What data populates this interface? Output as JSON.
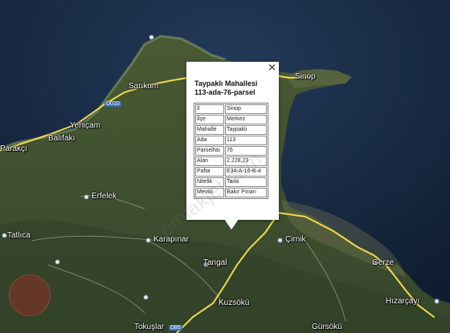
{
  "map": {
    "places": [
      {
        "id": "sarikum",
        "name": "Sarıkum"
      },
      {
        "id": "sinop",
        "name": "Sinop"
      },
      {
        "id": "yenicam",
        "name": "Yeniçam"
      },
      {
        "id": "balifaki",
        "name": "Balıfakı"
      },
      {
        "id": "parakci",
        "name": "Parakçı"
      },
      {
        "id": "erfelek",
        "name": "Erfelek"
      },
      {
        "id": "tatlica",
        "name": "Tatlıca"
      },
      {
        "id": "karapinar",
        "name": "Karapınar"
      },
      {
        "id": "cirnik",
        "name": "Çirnik"
      },
      {
        "id": "gerze",
        "name": "Gerze"
      },
      {
        "id": "tangal",
        "name": "Tangal"
      },
      {
        "id": "kuzsoku",
        "name": "Kuzsökü"
      },
      {
        "id": "hizarcayi",
        "name": "Hızarçayı"
      },
      {
        "id": "tokuslar",
        "name": "Tokuşlar"
      },
      {
        "id": "gursoku",
        "name": "Gürsökü"
      }
    ],
    "road_shields": [
      "D010",
      "D85"
    ]
  },
  "popup": {
    "title_line1": "Taypaklı Mahallesi",
    "title_line2": "113-ada-76-parsel",
    "close_symbol": "×",
    "rows": [
      {
        "key": "İl",
        "value": "Sinop"
      },
      {
        "key": "İlçe",
        "value": "Merkez"
      },
      {
        "key": "Mahalle",
        "value": "Taypaklı"
      },
      {
        "key": "Ada",
        "value": "113"
      },
      {
        "key": "ParselNo",
        "value": "76"
      },
      {
        "key": "Alan",
        "value": "2.228,23"
      },
      {
        "key": "Pafta",
        "value": "E34-A-16-B-4"
      },
      {
        "key": "Nitelik",
        "value": "Tarla"
      },
      {
        "key": "Mevkii",
        "value": "Bakır Pınarı"
      }
    ]
  },
  "watermark": "emlakjet.com"
}
